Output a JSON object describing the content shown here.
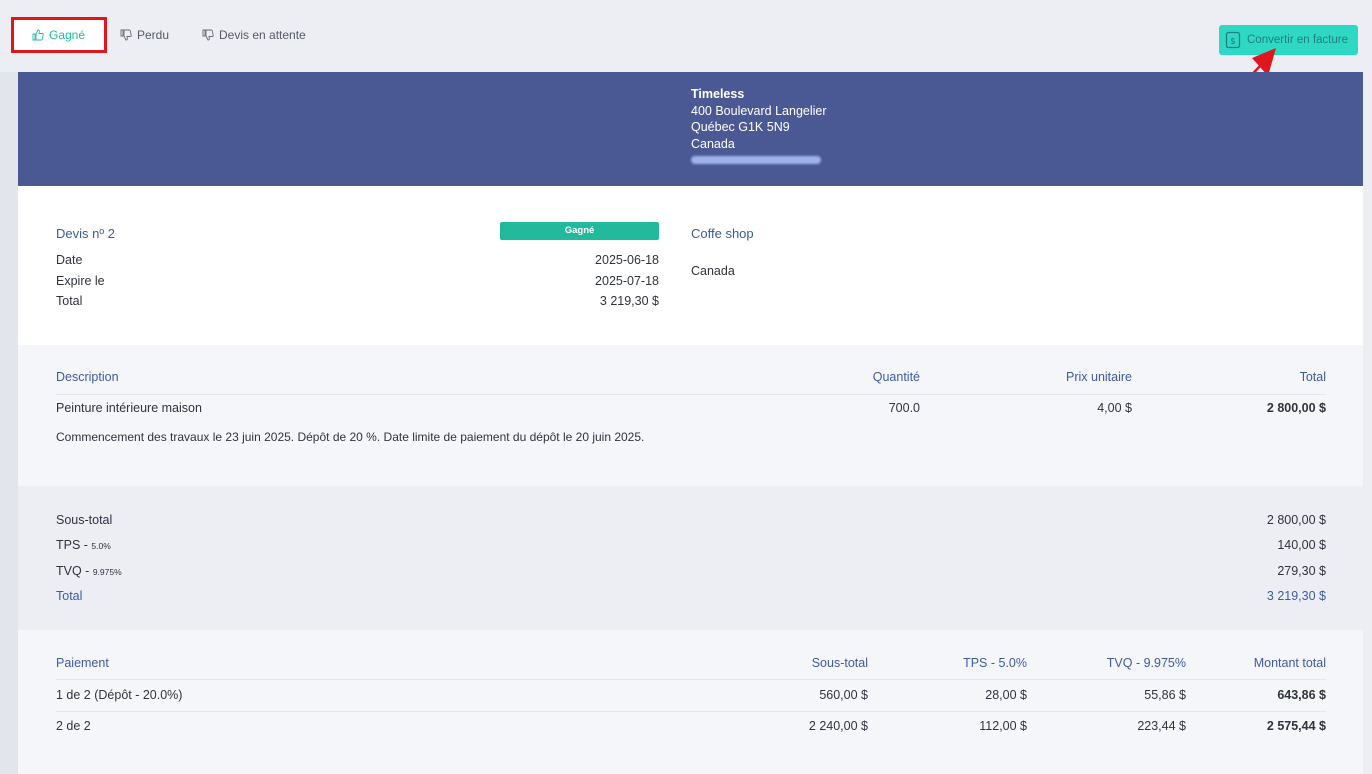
{
  "toolbar": {
    "tabs": [
      {
        "label": "Gagné"
      },
      {
        "label": "Perdu"
      },
      {
        "label": "Devis en attente"
      }
    ],
    "convert_label": "Convertir en facture"
  },
  "company": {
    "name": "Timeless",
    "address": "400 Boulevard Langelier",
    "city": "Québec G1K 5N9",
    "country": "Canada"
  },
  "quote": {
    "number_label": "Devis nº 2",
    "status": "Gagné",
    "date_label": "Date",
    "date": "2025-06-18",
    "expires_label": "Expire le",
    "expires": "2025-07-18",
    "total_label": "Total",
    "total": "3 219,30 $"
  },
  "client": {
    "name": "Coffe shop",
    "country": "Canada"
  },
  "items": {
    "headers": {
      "description": "Description",
      "quantity": "Quantité",
      "unit_price": "Prix unitaire",
      "total": "Total"
    },
    "rows": [
      {
        "name": "Peinture intérieure maison",
        "quantity": "700.0",
        "unit_price": "4,00 $",
        "total": "2 800,00 $",
        "note": "Commencement des travaux le 23 juin 2025. Dépôt de 20 %. Date limite de paiement du dépôt le 20 juin 2025."
      }
    ]
  },
  "totals": {
    "subtotal_label": "Sous-total",
    "subtotal": "2 800,00 $",
    "tps_label": "TPS - ",
    "tps_rate": "5.0%",
    "tps": "140,00 $",
    "tvq_label": "TVQ - ",
    "tvq_rate": "9.975%",
    "tvq": "279,30 $",
    "total_label": "Total",
    "total": "3 219,30 $"
  },
  "payments": {
    "headers": {
      "payment": "Paiement",
      "subtotal": "Sous-total",
      "tps": "TPS - 5.0%",
      "tvq": "TVQ - 9.975%",
      "amount": "Montant total"
    },
    "rows": [
      {
        "label": "1 de 2 (Dépôt - 20.0%)",
        "subtotal": "560,00 $",
        "tps": "28,00 $",
        "tvq": "55,86 $",
        "amount": "643,86 $"
      },
      {
        "label": "2 de 2",
        "subtotal": "2 240,00 $",
        "tps": "112,00 $",
        "tvq": "223,44 $",
        "amount": "2 575,44 $"
      }
    ]
  },
  "colors": {
    "banner": "#4a5994",
    "accent_teal": "#22b99c",
    "convert_button": "#2ed9c3",
    "highlight_red": "#e0161e",
    "label_blue": "#3e5aa0"
  }
}
